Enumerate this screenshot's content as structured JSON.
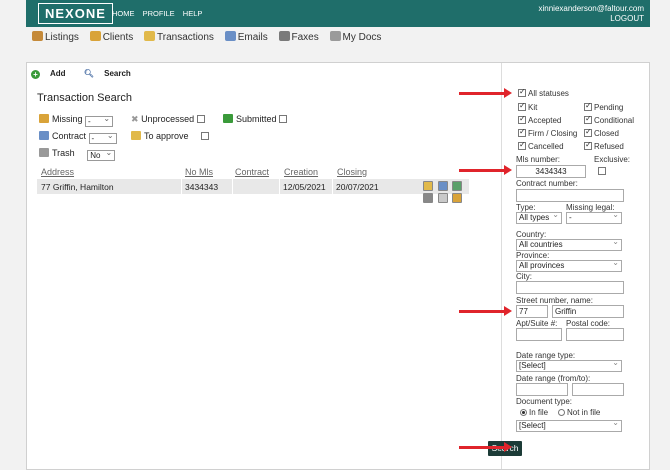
{
  "header": {
    "logo": "NEXONE",
    "nav": [
      "HOME",
      "PROFILE",
      "HELP"
    ],
    "user_email": "xinniexanderson@faltour.com",
    "logout": "LOGOUT"
  },
  "menubar": [
    {
      "label": "Listings",
      "icon": "house-icon",
      "color": "#c58a3a"
    },
    {
      "label": "Clients",
      "icon": "people-icon",
      "color": "#d9a339"
    },
    {
      "label": "Transactions",
      "icon": "folder-icon",
      "color": "#e1b94a"
    },
    {
      "label": "Emails",
      "icon": "envelope-icon",
      "color": "#6a8fc6"
    },
    {
      "label": "Faxes",
      "icon": "fax-icon",
      "color": "#7a7a7a"
    },
    {
      "label": "My Docs",
      "icon": "documents-icon",
      "color": "#9a9a9a"
    }
  ],
  "toolbar": {
    "add": "Add",
    "search": "Search"
  },
  "left": {
    "title": "Transaction Search",
    "filters": {
      "missing_label": "Missing",
      "missing_value": "-",
      "unprocessed_label": "Unprocessed",
      "submitted_label": "Submitted",
      "contract_label": "Contract",
      "contract_value": "-",
      "to_approve_label": "To approve",
      "trash_label": "Trash",
      "trash_value": "No"
    },
    "table": {
      "headers": [
        "Address",
        "No Mls",
        "Contract",
        "Creation",
        "Closing"
      ],
      "rows": [
        {
          "address": "77 Griffin, Hamilton",
          "mls": "3434343",
          "contract": "",
          "creation": "12/05/2021",
          "closing": "20/07/2021"
        }
      ]
    }
  },
  "right": {
    "all_statuses": "All statuses",
    "statuses": [
      "Kit",
      "Pending",
      "Accepted",
      "Conditional",
      "Firm / Closing",
      "Closed",
      "Cancelled",
      "Refused"
    ],
    "mls_label": "Mls number:",
    "exclusive_label": "Exclusive:",
    "mls_value": "3434343",
    "contract_number_label": "Contract number:",
    "type_label": "Type:",
    "type_value": "All types",
    "missing_legal_label": "Missing legal:",
    "missing_legal_value": "-",
    "country_label": "Country:",
    "country_value": "All countries",
    "province_label": "Province:",
    "province_value": "All provinces",
    "city_label": "City:",
    "street_label": "Street number, name:",
    "street_number": "77",
    "street_name": "Griffin",
    "apt_label": "Apt/Suite #:",
    "postal_label": "Postal code:",
    "date_range_type_label": "Date range type:",
    "date_range_type_value": "[Select]",
    "date_range_label": "Date range (from/to):",
    "document_type_label": "Document type:",
    "in_file": "In file",
    "not_in_file": "Not in file",
    "document_type_value": "[Select]",
    "search_button": "Search"
  },
  "colors": {
    "header": "#1f6e6a",
    "search_button": "#1c3b37",
    "arrow": "#e0242b"
  }
}
